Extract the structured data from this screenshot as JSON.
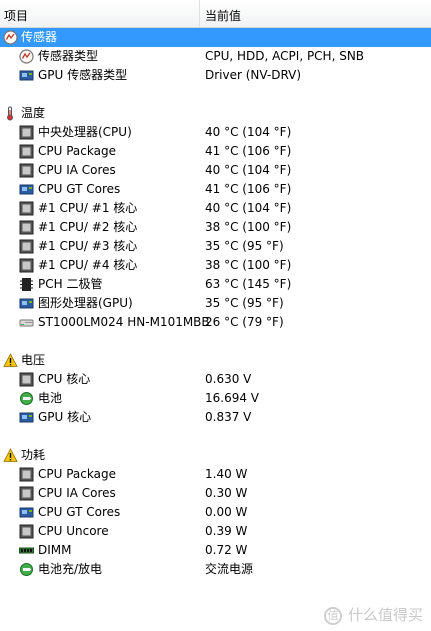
{
  "header": {
    "col_item": "项目",
    "col_value": "当前值"
  },
  "groups": {
    "sensor": {
      "title": "传感器",
      "icon": "sensor-gauge-icon",
      "items": [
        {
          "label": "传感器类型",
          "value": "CPU, HDD, ACPI, PCH, SNB",
          "icon": "sensor-gauge-icon"
        },
        {
          "label": "GPU 传感器类型",
          "value": "Driver  (NV-DRV)",
          "icon": "gpu-card-icon"
        }
      ]
    },
    "temperature": {
      "title": "温度",
      "icon": "thermometer-icon",
      "items": [
        {
          "label": "中央处理器(CPU)",
          "value": "40 °C  (104 °F)",
          "icon": "cpu-chip-icon"
        },
        {
          "label": "CPU Package",
          "value": "41 °C  (106 °F)",
          "icon": "cpu-chip-icon"
        },
        {
          "label": "CPU IA Cores",
          "value": "40 °C  (104 °F)",
          "icon": "cpu-chip-icon"
        },
        {
          "label": "CPU GT Cores",
          "value": "41 °C  (106 °F)",
          "icon": "gpu-card-icon"
        },
        {
          "label": "#1 CPU/ #1 核心",
          "value": "40 °C  (104 °F)",
          "icon": "cpu-chip-icon"
        },
        {
          "label": "#1 CPU/ #2 核心",
          "value": "38 °C  (100 °F)",
          "icon": "cpu-chip-icon"
        },
        {
          "label": "#1 CPU/ #3 核心",
          "value": "35 °C  (95 °F)",
          "icon": "cpu-chip-icon"
        },
        {
          "label": "#1 CPU/ #4 核心",
          "value": "38 °C  (100 °F)",
          "icon": "cpu-chip-icon"
        },
        {
          "label": "PCH 二极管",
          "value": "63 °C  (145 °F)",
          "icon": "chipset-icon"
        },
        {
          "label": "图形处理器(GPU)",
          "value": "35 °C  (95 °F)",
          "icon": "gpu-card-icon"
        },
        {
          "label": "ST1000LM024 HN-M101MBB",
          "value": "26 °C  (79 °F)",
          "icon": "hard-disk-icon"
        }
      ]
    },
    "voltage": {
      "title": "电压",
      "icon": "warning-icon",
      "items": [
        {
          "label": "CPU 核心",
          "value": "0.630 V",
          "icon": "cpu-chip-icon"
        },
        {
          "label": "电池",
          "value": "16.694 V",
          "icon": "battery-icon"
        },
        {
          "label": "GPU 核心",
          "value": "0.837 V",
          "icon": "gpu-card-icon"
        }
      ]
    },
    "power": {
      "title": "功耗",
      "icon": "warning-icon",
      "items": [
        {
          "label": "CPU Package",
          "value": "1.40 W",
          "icon": "cpu-chip-icon"
        },
        {
          "label": "CPU IA Cores",
          "value": "0.30 W",
          "icon": "cpu-chip-icon"
        },
        {
          "label": "CPU GT Cores",
          "value": "0.00 W",
          "icon": "gpu-card-icon"
        },
        {
          "label": "CPU Uncore",
          "value": "0.39 W",
          "icon": "cpu-chip-icon"
        },
        {
          "label": "DIMM",
          "value": "0.72 W",
          "icon": "memory-module-icon"
        },
        {
          "label": "电池充/放电",
          "value": "交流电源",
          "icon": "battery-icon"
        }
      ]
    }
  },
  "watermark": {
    "glyph": "值",
    "text": "什么值得买"
  },
  "colors": {
    "selection": "#3399ff",
    "header_bg": "#f1f2f4"
  }
}
